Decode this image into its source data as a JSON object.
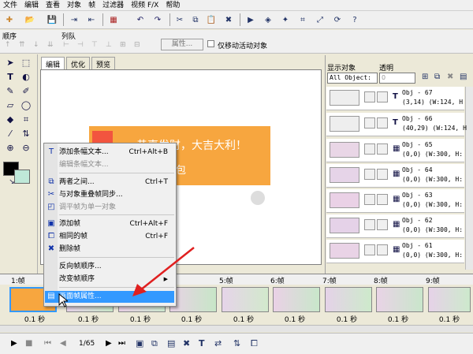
{
  "menubar": [
    "文件",
    "编辑",
    "查看",
    "对象",
    "帧",
    "过滤器",
    "视频 F/X",
    "帮助"
  ],
  "toolbar2": {
    "order_label": "顺序",
    "queue_label": "列队",
    "properties_label": "属性...",
    "only_active_label": "仅移动活动对象"
  },
  "tabs": [
    "编辑",
    "优化",
    "预览"
  ],
  "canvas": {
    "text_line1": "恭喜发财，大吉大利！",
    "text_line2": "包"
  },
  "right_panel": {
    "show_objects_label": "显示对象",
    "transparency_label": "透明",
    "select_value": "All Object:",
    "spin_value": "0",
    "objects": [
      {
        "name": "Obj - 67",
        "info": "(3,14) (W:124, H"
      },
      {
        "name": "Obj - 66",
        "info": "(40,29) (W:124, H"
      },
      {
        "name": "Obj - 65",
        "info": "(0,0) (W:300, H:"
      },
      {
        "name": "Obj - 64",
        "info": "(0,0) (W:300, H:"
      },
      {
        "name": "Obj - 63",
        "info": "(0,0) (W:300, H:"
      },
      {
        "name": "Obj - 62",
        "info": "(0,0) (W:300, H:"
      },
      {
        "name": "Obj - 61",
        "info": "(0,0) (W:300, H:"
      }
    ]
  },
  "timeline": {
    "frames": [
      "1:帧",
      "5:帧",
      "6:帧",
      "7:帧",
      "8:帧",
      "9:帧"
    ],
    "times": [
      "0.1 秒",
      "0.1 秒",
      "0.1 秒",
      "0.1 秒",
      "0.1 秒",
      "0.1 秒",
      "0.1 秒",
      "0.1 秒",
      "0.1 秒"
    ],
    "page": "1/65"
  },
  "context_menu": {
    "items": [
      {
        "label": "添加条幅文本...",
        "shortcut": "Ctrl+Alt+B",
        "icon": "T",
        "disabled": false
      },
      {
        "label": "编辑条幅文本...",
        "shortcut": "",
        "icon": "",
        "disabled": true
      },
      {
        "label": "两者之间...",
        "shortcut": "Ctrl+T",
        "icon": "⧉",
        "disabled": false
      },
      {
        "label": "与对象重叠帧同步...",
        "shortcut": "",
        "icon": "✂",
        "disabled": false
      },
      {
        "label": "调平帧为单一对象",
        "shortcut": "",
        "icon": "◰",
        "disabled": true
      },
      {
        "label": "添加帧",
        "shortcut": "Ctrl+Alt+F",
        "icon": "▣",
        "disabled": false
      },
      {
        "label": "相同的帧",
        "shortcut": "Ctrl+F",
        "icon": "⧠",
        "disabled": false
      },
      {
        "label": "删除帧",
        "shortcut": "",
        "icon": "✖",
        "disabled": false
      },
      {
        "label": "反向帧顺序...",
        "shortcut": "",
        "icon": "",
        "disabled": false
      },
      {
        "label": "改变帧顺序",
        "shortcut": "",
        "icon": "",
        "disabled": false,
        "submenu": true
      },
      {
        "label": "画面帧属性...",
        "shortcut": "",
        "icon": "▤",
        "disabled": false,
        "selected": true
      }
    ]
  },
  "colors": {
    "accent": "#3399ff",
    "canvas_orange": "#f7a63f",
    "arrow_red": "#e02020",
    "fg_swatch": "#000000",
    "bg_swatch": "#bfe8d8"
  }
}
